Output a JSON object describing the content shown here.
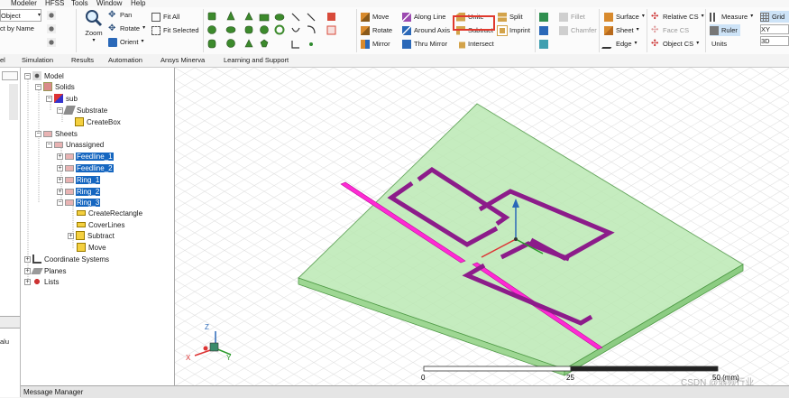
{
  "menu": [
    "Modeler",
    "HFSS",
    "Tools",
    "Window",
    "Help"
  ],
  "ribbon": {
    "select_object": "Object",
    "select_by_name": "ct by Name",
    "pan": "Pan",
    "rotate": "Rotate",
    "orient": "Orient",
    "zoom": "Zoom",
    "fit_all": "Fit All",
    "fit_selected": "Fit Selected",
    "move": "Move",
    "rotate_op": "Rotate",
    "mirror": "Mirror",
    "along_line": "Along Line",
    "around_axis": "Around Axis",
    "thru_mirror": "Thru Mirror",
    "unite": "Unite",
    "subtract": "Subtract",
    "intersect": "Intersect",
    "split": "Split",
    "imprint": "Imprint",
    "fillet": "Fillet",
    "chamfer": "Chamfer",
    "surface": "Surface",
    "sheet": "Sheet",
    "edge": "Edge",
    "relative_cs": "Relative CS",
    "face_cs": "Face CS",
    "object_cs": "Object CS",
    "measure": "Measure",
    "ruler": "Ruler",
    "units": "Units",
    "grid": "Grid",
    "grid_plane": "XY",
    "grid_mode": "3D"
  },
  "tabs": [
    "el",
    "Simulation",
    "Results",
    "Automation",
    "Ansys Minerva",
    "Learning and Support"
  ],
  "tree": {
    "model": "Model",
    "solids": "Solids",
    "sub": "sub",
    "substrate": "Substrate",
    "createbox": "CreateBox",
    "sheets": "Sheets",
    "unassigned": "Unassigned",
    "feedline1": "Feedline_1",
    "feedline2": "Feedline_2",
    "ring1": "Ring_1",
    "ring2": "Ring_2",
    "ring3": "Ring_3",
    "createrect": "CreateRectangle",
    "coverlines": "CoverLines",
    "subtract": "Subtract",
    "move": "Move",
    "coords": "Coordinate Systems",
    "planes": "Planes",
    "lists": "Lists"
  },
  "left_strip": {
    "value_label": "alu"
  },
  "viewport": {
    "scale_0": "0",
    "scale_25": "25",
    "scale_50": "50 (mm)",
    "axis_x": "X",
    "axis_y": "Y",
    "axis_z": "Z",
    "watermark": "CSDN @弱频行业"
  },
  "message_manager": "Message Manager",
  "colors": {
    "substrate_fill": "#b6e7b0",
    "substrate_edge": "#4f9a46",
    "ring": "#8c1c8a",
    "feedline": "#ff2ad4",
    "tree_selection": "#1566c0",
    "unite_highlight": "#e03a2e"
  }
}
